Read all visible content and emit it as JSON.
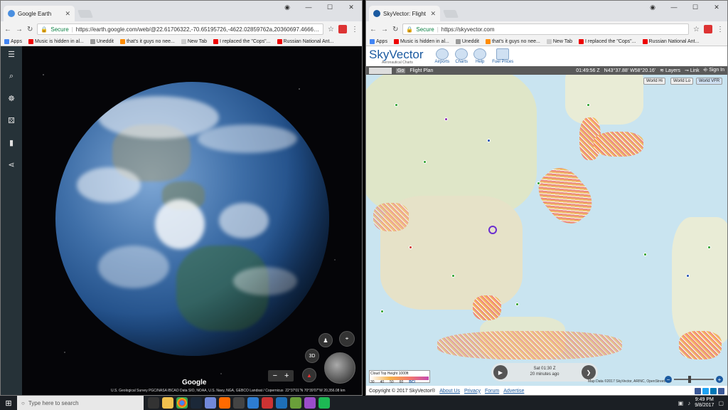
{
  "left_window": {
    "tab_title": "Google Earth",
    "url_secure": "Secure",
    "url": "https://earth.google.com/web/@22.61706322,-70.65195726,-4622.02859762a,20360697.4666214d,35y,-0h,0t...",
    "bookmarks": [
      "Apps",
      "Music is hidden in al...",
      "Uneddit",
      "that's it guys no nee...",
      "New Tab",
      "I replaced the \"Cops\"...",
      "Russian National Ant..."
    ],
    "earth": {
      "logo": "Google",
      "attribution": "U.S. Geological Survey  PGC/NASA  IBCAO  Data SIO, NOAA, U.S. Navy, NGA, GEBCO  Landsat / Copernicus",
      "coords": "22°37'01\"N 70°39'07\"W",
      "alt": "20,356.08 km",
      "btn_3d": "3D",
      "zoom_minus": "−",
      "zoom_plus": "+"
    }
  },
  "right_window": {
    "tab_title": "SkyVector: Flight Planning...",
    "url_secure": "Secure",
    "url": "https://skyvector.com",
    "bookmarks": [
      "Apps",
      "Music is hidden in al...",
      "Uneddit",
      "that's it guys no nee...",
      "New Tab",
      "I replaced the \"Cops\"...",
      "Russian National Ant..."
    ],
    "logo": "SkyVector",
    "logo_sub": "Aeronautical Charts",
    "nav": [
      "Airports",
      "Charts",
      "Help",
      "Fuel Prices"
    ],
    "bar": {
      "flight_plan": "Flight Plan",
      "time": "01:49:56 Z",
      "coords": "N43°37.88' W58°20.16'",
      "layers": "Layers",
      "link": "Link",
      "signin": "Sign In"
    },
    "chart_buttons": [
      "World Hi",
      "World Lo",
      "World VFR"
    ],
    "player": {
      "time": "Sat 01:30 Z",
      "ago": "20 minutes ago"
    },
    "cloud_key": {
      "title": "Cloud Top Height 1000ft",
      "ticks": [
        "30",
        "40",
        "50",
        "60"
      ],
      "brand": "BCI"
    },
    "map_credit": "Map Data ©2017 SkyVector, ARINC, OpenStreetMap",
    "footer": {
      "copyright": "Copyright © 2017 SkyVector®",
      "links": [
        "About Us",
        "Privacy",
        "Forum",
        "Advertise"
      ]
    }
  },
  "taskbar": {
    "search_placeholder": "Type here to search",
    "time": "9:49 PM",
    "date": "9/8/2017"
  }
}
